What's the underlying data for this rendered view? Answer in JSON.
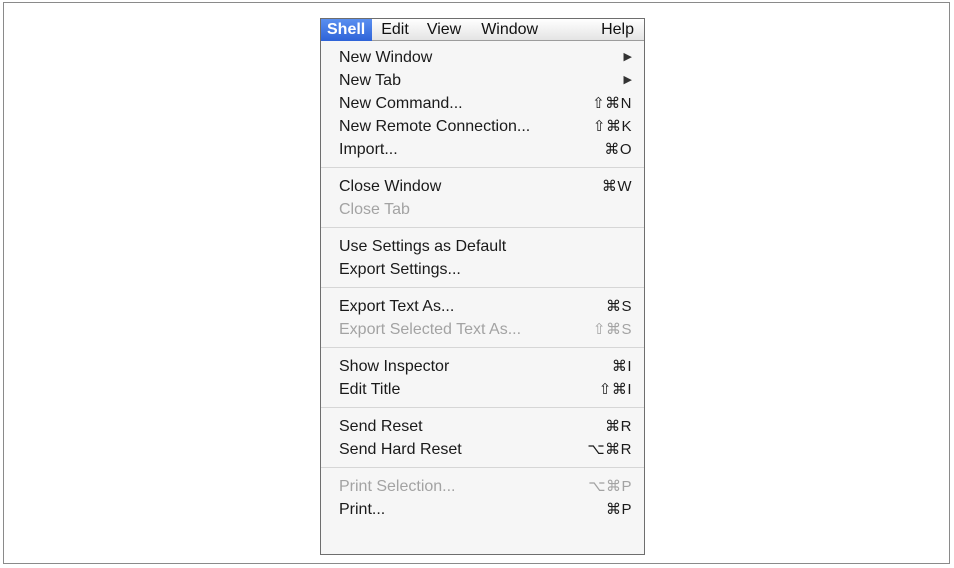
{
  "menubar": {
    "items": [
      "Shell",
      "Edit",
      "View",
      "Window",
      "Help"
    ]
  },
  "menu": {
    "groups": [
      [
        {
          "label": "New Window",
          "shortcut": "",
          "submenu": true,
          "disabled": false
        },
        {
          "label": "New Tab",
          "shortcut": "",
          "submenu": true,
          "disabled": false
        },
        {
          "label": "New Command...",
          "shortcut": "⇧⌘N",
          "submenu": false,
          "disabled": false
        },
        {
          "label": "New Remote Connection...",
          "shortcut": "⇧⌘K",
          "submenu": false,
          "disabled": false
        },
        {
          "label": "Import...",
          "shortcut": "⌘O",
          "submenu": false,
          "disabled": false
        }
      ],
      [
        {
          "label": "Close Window",
          "shortcut": "⌘W",
          "submenu": false,
          "disabled": false
        },
        {
          "label": "Close Tab",
          "shortcut": "",
          "submenu": false,
          "disabled": true
        }
      ],
      [
        {
          "label": "Use Settings as Default",
          "shortcut": "",
          "submenu": false,
          "disabled": false
        },
        {
          "label": "Export Settings...",
          "shortcut": "",
          "submenu": false,
          "disabled": false
        }
      ],
      [
        {
          "label": "Export Text As...",
          "shortcut": "⌘S",
          "submenu": false,
          "disabled": false
        },
        {
          "label": "Export Selected Text As...",
          "shortcut": "⇧⌘S",
          "submenu": false,
          "disabled": true
        }
      ],
      [
        {
          "label": "Show Inspector",
          "shortcut": "⌘I",
          "submenu": false,
          "disabled": false
        },
        {
          "label": "Edit Title",
          "shortcut": "⇧⌘I",
          "submenu": false,
          "disabled": false
        }
      ],
      [
        {
          "label": "Send Reset",
          "shortcut": "⌘R",
          "submenu": false,
          "disabled": false
        },
        {
          "label": "Send Hard Reset",
          "shortcut": "⌥⌘R",
          "submenu": false,
          "disabled": false
        }
      ],
      [
        {
          "label": "Print Selection...",
          "shortcut": "⌥⌘P",
          "submenu": false,
          "disabled": true
        },
        {
          "label": "Print...",
          "shortcut": "⌘P",
          "submenu": false,
          "disabled": false
        }
      ]
    ]
  },
  "icons": {
    "submenu_arrow": "▶"
  },
  "colors": {
    "selection": "#3a70e0",
    "disabled_text": "#a3a3a3"
  }
}
